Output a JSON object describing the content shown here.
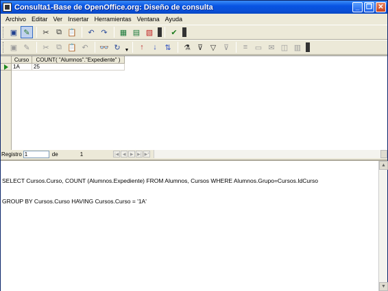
{
  "window": {
    "title": "Consulta1-Base de OpenOffice.org: Diseño de consulta"
  },
  "menu": [
    "Archivo",
    "Editar",
    "Ver",
    "Insertar",
    "Herramientas",
    "Ventana",
    "Ayuda"
  ],
  "grid": {
    "columns": [
      "Curso",
      "COUNT( \"Alumnos\".\"Expediente\" )"
    ],
    "rows": [
      [
        "1A",
        "25"
      ]
    ]
  },
  "record_bar": {
    "label": "Registro",
    "current": "1",
    "of_label": "de",
    "total": "1"
  },
  "sql": {
    "line1": "SELECT Cursos.Curso, COUNT (Alumnos.Expediente) FROM Alumnos, Cursos WHERE Alumnos.Grupo=Cursos.IdCurso",
    "line2": "GROUP BY Cursos.Curso HAVING Cursos.Curso = '1A'"
  }
}
